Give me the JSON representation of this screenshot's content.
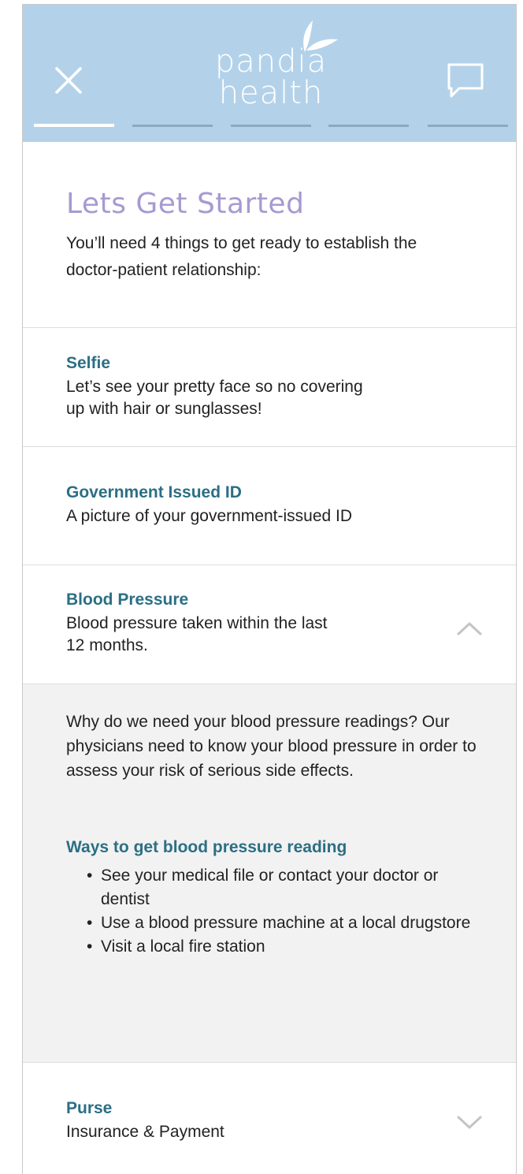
{
  "header": {
    "logo_line1": "pandia",
    "logo_line2": "health",
    "progress": {
      "steps_total": 5,
      "current_step": 1
    }
  },
  "intro": {
    "title": "Lets Get Started",
    "description": "You’ll need 4 things to get ready to establish the doctor-patient relationship:"
  },
  "items": [
    {
      "title": "Selfie",
      "description": "Let’s see your pretty face so no covering up with hair or sunglasses!"
    },
    {
      "title": "Government Issued ID",
      "description": "A picture of your government-issued ID"
    },
    {
      "title": "Blood Pressure",
      "description": "Blood pressure taken within the last 12 months.",
      "state": "expanded"
    },
    {
      "title": "Purse",
      "description": "Insurance & Payment",
      "state": "collapsed"
    }
  ],
  "blood_pressure_detail": {
    "why": "Why do we need your blood pressure readings? Our physicians need to know your blood pressure in order to assess your risk of serious side effects.",
    "ways_title": "Ways to get blood pressure reading",
    "ways": [
      "See your medical file or contact your doctor or dentist",
      "Use a blood pressure machine at a local drugstore",
      "Visit a local fire station"
    ]
  },
  "colors": {
    "header_bg": "#b3d2ea",
    "title_purple": "#a79ad1",
    "item_title_teal": "#2b6f84",
    "expanded_bg": "#f2f2f2"
  },
  "icons": {
    "close": "close-icon",
    "chat": "chat-icon",
    "expand": "chevron-up-icon",
    "collapse": "chevron-down-icon"
  }
}
